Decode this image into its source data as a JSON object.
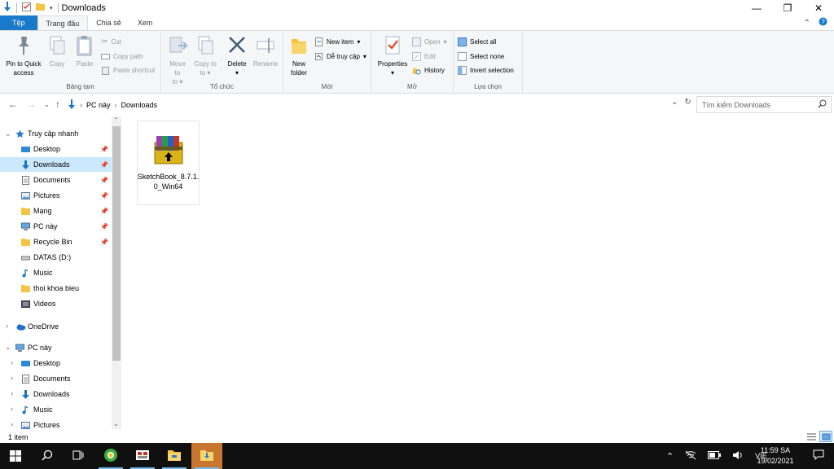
{
  "window": {
    "title": "Downloads",
    "minimize": "—",
    "restore": "❐",
    "close": "✕"
  },
  "ribbon_tabs": [
    {
      "label": "Tệp"
    },
    {
      "label": "Trang đầu"
    },
    {
      "label": "Chia sẻ"
    },
    {
      "label": "Xem"
    }
  ],
  "ribbon": {
    "clipboard": {
      "label": "Bảng tạm",
      "pin": "Pin to Quick access",
      "copy": "Copy",
      "paste": "Paste",
      "cut": "Cut",
      "copy_path": "Copy path",
      "paste_shortcut": "Paste shortcut"
    },
    "organize": {
      "label": "Tổ chức",
      "move_to": "Move to",
      "copy_to": "Copy to",
      "delete": "Delete",
      "rename": "Rename"
    },
    "new": {
      "label": "Mới",
      "new_folder": "New folder",
      "new_item": "New item",
      "easy_access": "Dễ truy cập"
    },
    "open": {
      "label": "Mở",
      "properties": "Properties",
      "open": "Open",
      "edit": "Edit",
      "history": "History"
    },
    "select": {
      "label": "Lựa chọn",
      "select_all": "Select all",
      "select_none": "Select none",
      "invert": "Invert selection"
    }
  },
  "address": {
    "crumbs": [
      "PC này",
      "Downloads"
    ],
    "search_placeholder": "Tìm kiếm Downloads"
  },
  "nav": {
    "quick_access": "Truy cập nhanh",
    "quick_items": [
      {
        "label": "Desktop",
        "icon": "desktop-icon"
      },
      {
        "label": "Downloads",
        "icon": "download-arrow-icon"
      },
      {
        "label": "Documents",
        "icon": "documents-icon"
      },
      {
        "label": "Pictures",
        "icon": "pictures-icon"
      },
      {
        "label": "Mạng",
        "icon": "folder-icon"
      },
      {
        "label": "PC này",
        "icon": "computer-icon"
      },
      {
        "label": "Recycle Bin",
        "icon": "folder-icon"
      },
      {
        "label": "DATAS (D:)",
        "icon": "drive-icon"
      },
      {
        "label": "Music",
        "icon": "music-icon"
      },
      {
        "label": "thoi khoa bieu",
        "icon": "folder-icon"
      },
      {
        "label": "Videos",
        "icon": "videos-icon"
      }
    ],
    "onedrive": "OneDrive",
    "this_pc": "PC này",
    "pc_items": [
      {
        "label": "Desktop"
      },
      {
        "label": "Documents"
      },
      {
        "label": "Downloads"
      },
      {
        "label": "Music"
      },
      {
        "label": "Pictures"
      }
    ]
  },
  "files": [
    {
      "name": "SketchBook_8.7.1.0_Win64",
      "icon": "winrar-archive-icon"
    }
  ],
  "status": {
    "count": "1 item"
  },
  "taskbar": {
    "lang": "VIE",
    "time": "11:59 SA",
    "date": "19/02/2021"
  },
  "colors": {
    "accent": "#1979ca",
    "selected_nav": "#cce8ff",
    "taskbar": "#101010"
  }
}
